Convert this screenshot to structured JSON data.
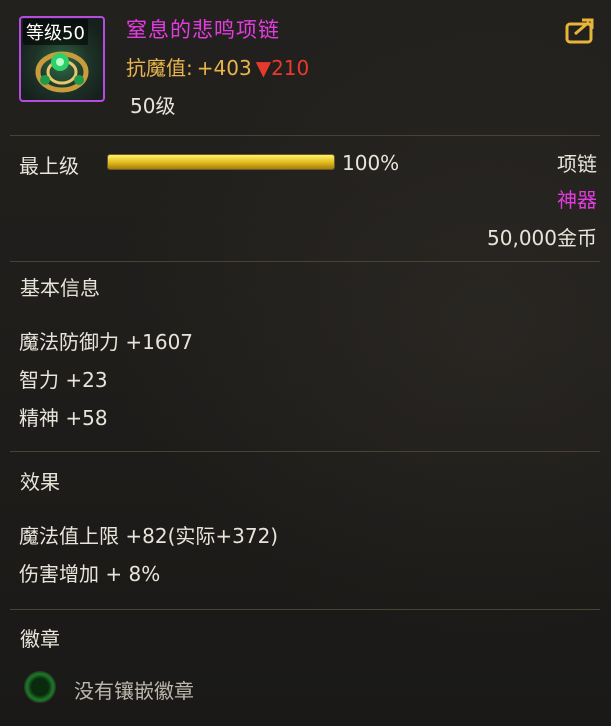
{
  "item": {
    "level_badge": "等级50",
    "name": "窒息的悲鸣项链",
    "stat_label": "抗魔值:",
    "stat_value": "+403",
    "stat_diff": "▼210",
    "required_level": "50级",
    "icon": "necklace-icon",
    "share_icon": "share-icon"
  },
  "upgrade": {
    "label": "最上级",
    "progress_percent": 100,
    "percent_text": "100%"
  },
  "meta": {
    "type": "项链",
    "rarity": "神器",
    "price": "50,000金币"
  },
  "basic": {
    "title": "基本信息",
    "lines": [
      "魔法防御力 +1607",
      "智力 +23",
      "精神 +58"
    ]
  },
  "effects": {
    "title": "效果",
    "lines": [
      "魔法值上限 +82(实际+372)",
      "伤害增加 + 8%"
    ]
  },
  "emblem": {
    "title": "徽章",
    "empty_text": "没有镶嵌徽章"
  },
  "colors": {
    "name": "#e23ce0",
    "stat": "#e9b54a",
    "decrease": "#e83a2c",
    "divider": "#4a4235"
  }
}
